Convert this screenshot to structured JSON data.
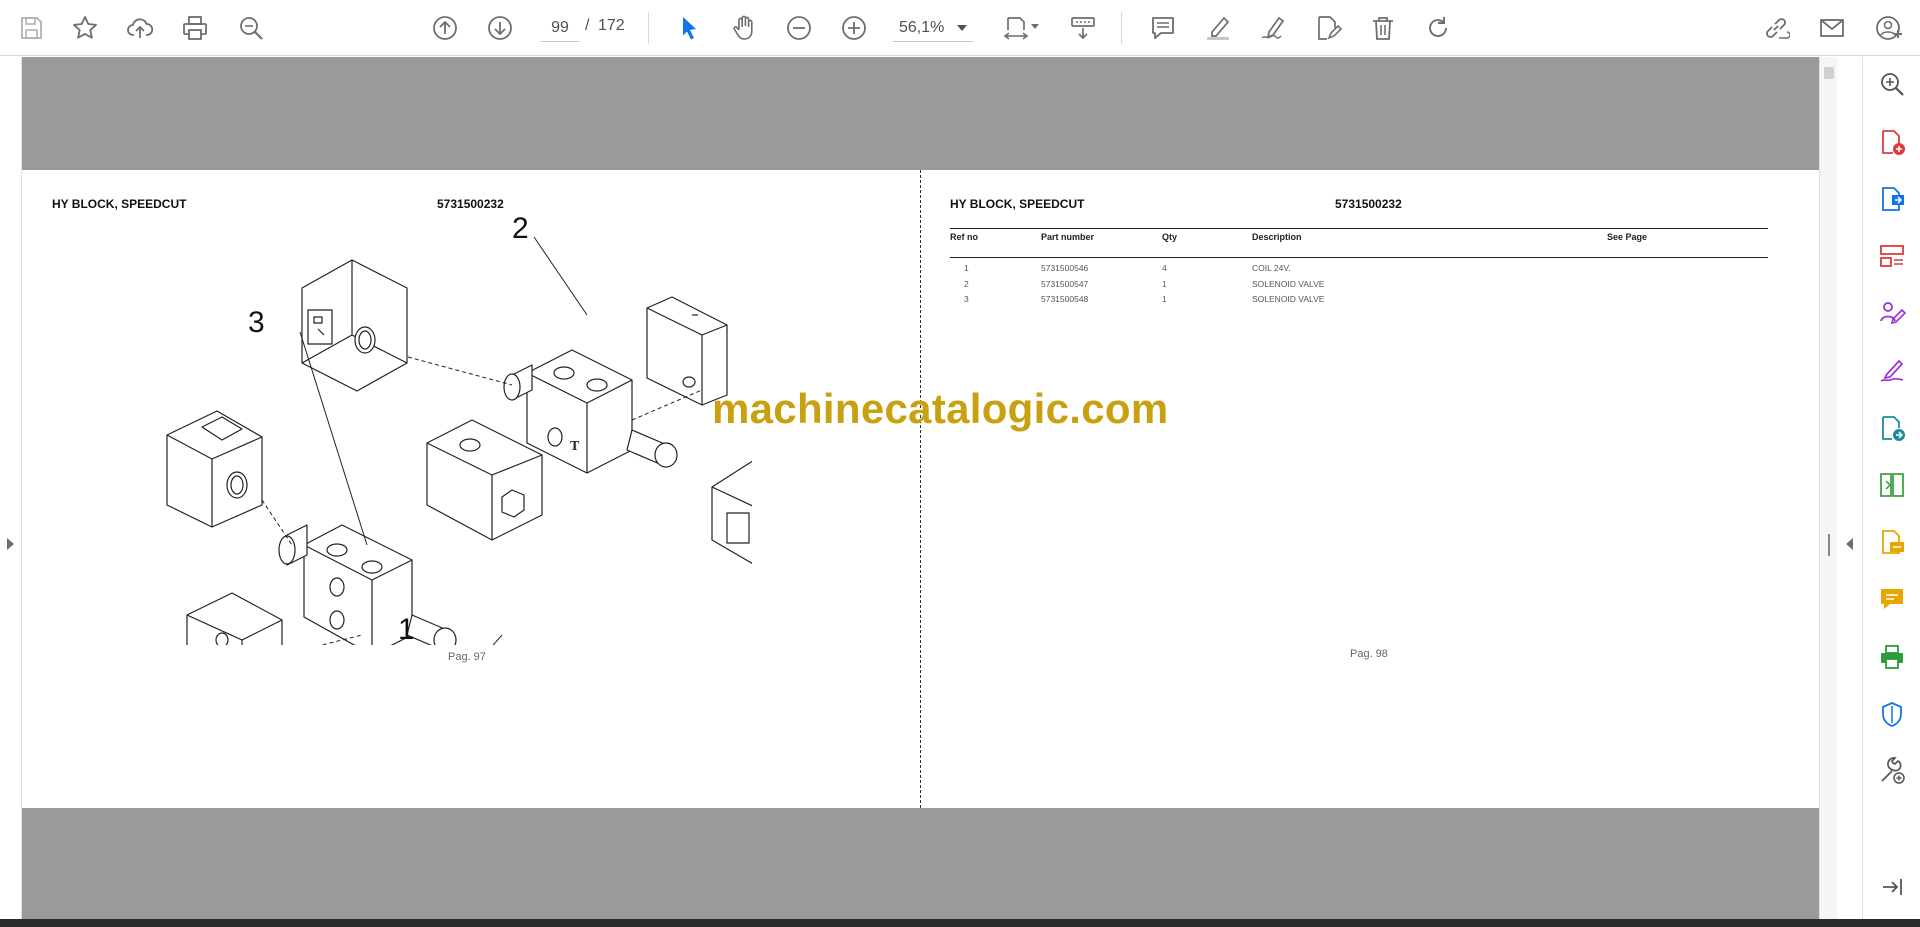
{
  "toolbar": {
    "current_page": "99",
    "page_separator": "/",
    "total_pages": "172",
    "zoom": "56,1%"
  },
  "colors": {
    "accent": "#1473e6",
    "viewport_bg": "#9a9a9a",
    "watermark": "#c8a010"
  },
  "icons": {
    "toolbar": [
      "save-icon",
      "star-icon",
      "cloud-upload-icon",
      "print-icon",
      "zoom-search-icon",
      "page-up-icon",
      "page-down-icon",
      "select-cursor-icon",
      "hand-icon",
      "zoom-out-icon",
      "zoom-in-icon",
      "fit-page-icon",
      "scroll-mode-icon",
      "comment-icon",
      "highlight-icon",
      "sign-icon",
      "edit-document-icon",
      "delete-icon",
      "rotate-icon",
      "share-link-icon",
      "email-icon",
      "account-icon"
    ],
    "tools": [
      "zoom-tool-icon",
      "create-pdf-icon",
      "export-pdf-icon",
      "organize-pages-icon",
      "request-signatures-icon",
      "fill-sign-icon",
      "send-review-icon",
      "compare-files-icon",
      "export-file-icon",
      "comment-tool-icon",
      "print-production-icon",
      "protect-icon",
      "more-tools-icon",
      "collapse-panel-icon"
    ]
  },
  "left_page": {
    "title": "HY BLOCK, SPEEDCUT",
    "part_no": "5731500232",
    "callouts": [
      "1",
      "2",
      "3"
    ],
    "footer": "Pag. 97"
  },
  "right_page": {
    "title": "HY BLOCK, SPEEDCUT",
    "part_no": "5731500232",
    "footer": "Pag. 98",
    "table": {
      "headers": [
        "Ref no",
        "Part number",
        "Qty",
        "Description",
        "See Page"
      ],
      "rows": [
        [
          "1",
          "5731500546",
          "4",
          "COIL 24V.",
          ""
        ],
        [
          "2",
          "5731500547",
          "1",
          "SOLENOID VALVE",
          ""
        ],
        [
          "3",
          "5731500548",
          "1",
          "SOLENOID VALVE",
          ""
        ]
      ]
    }
  },
  "watermark": "machinecatalogic.com"
}
